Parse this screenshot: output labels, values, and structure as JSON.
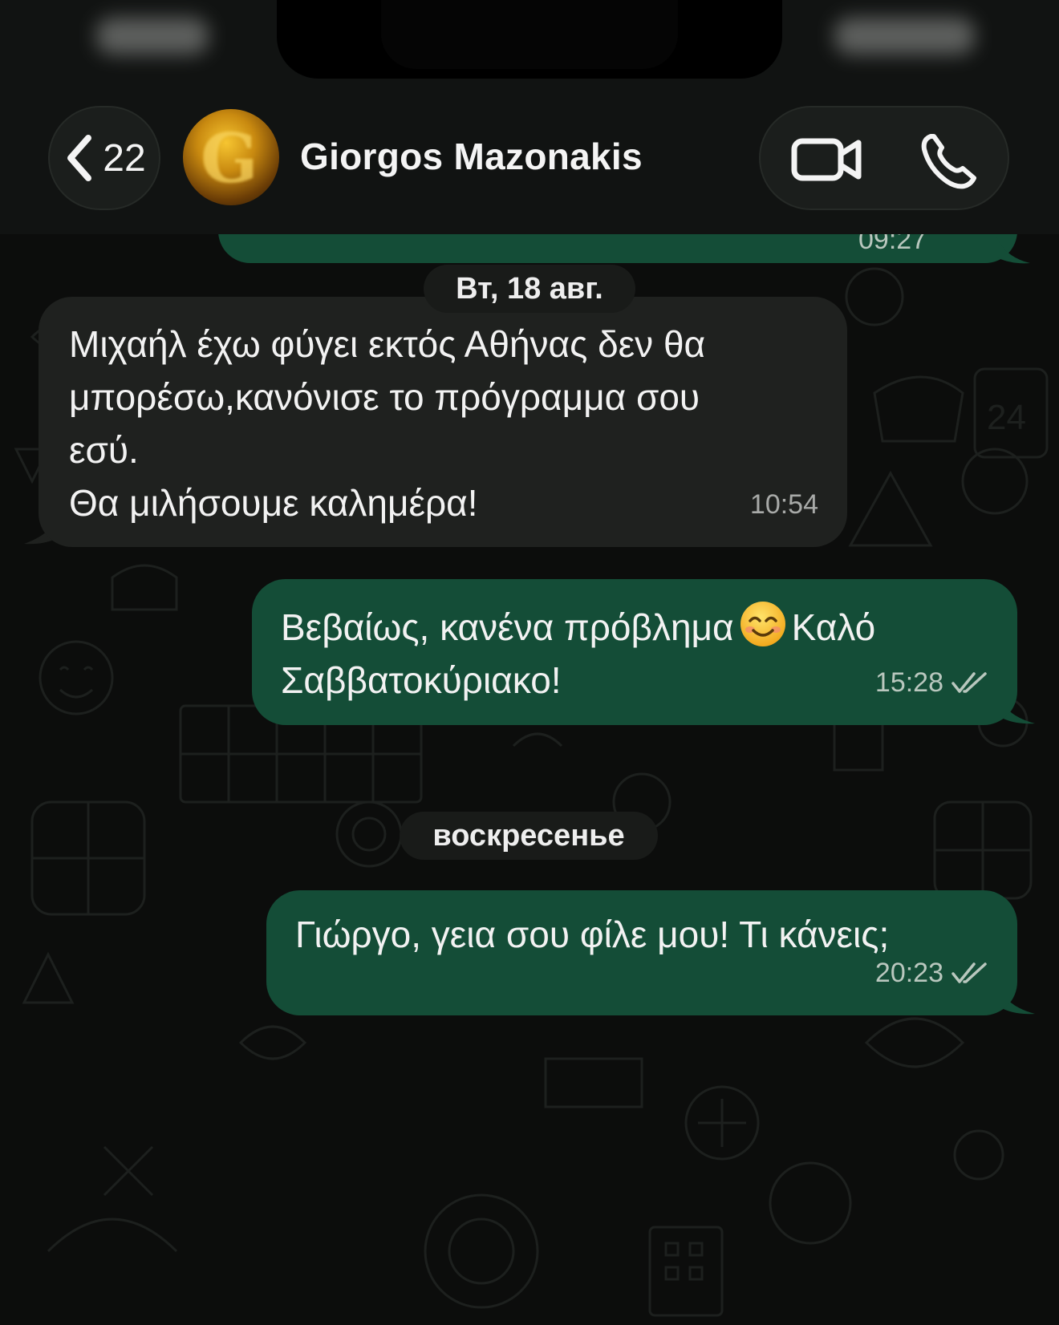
{
  "status_bar": {},
  "header": {
    "back_count": "22",
    "contact_name": "Giorgos Mazonakis",
    "avatar_letter": "G"
  },
  "top_clipped_message": {
    "time": "09:27"
  },
  "messages": [
    {
      "kind": "date",
      "label": "Вт, 18 авг."
    },
    {
      "kind": "incoming",
      "text": "Μιχαήλ έχω φύγει εκτός Αθήνας δεν θα\nμπορέσω,κανόνισε το πρόγραμμα σου\nεσύ.\nΘα μιλήσουμε καλημέρα!",
      "time": "10:54"
    },
    {
      "kind": "outgoing",
      "text_before_emoji": "Βεβαίως, κανένα πρόβλημα",
      "emoji": "smiling-face-emoji",
      "text_after_emoji": "Καλό",
      "text_line2": "Σαββατοκύριακο!",
      "time": "15:28",
      "status": "read-double-check"
    },
    {
      "kind": "date",
      "label": "воскресенье"
    },
    {
      "kind": "outgoing",
      "text": "Γιώργο, γεια σου φίλε μου! Τι κάνεις;",
      "time": "20:23",
      "status": "read-double-check"
    }
  ],
  "colors": {
    "outgoing_bubble": "#144d37",
    "incoming_bubble": "#1f211f",
    "background": "#0c0d0c"
  }
}
